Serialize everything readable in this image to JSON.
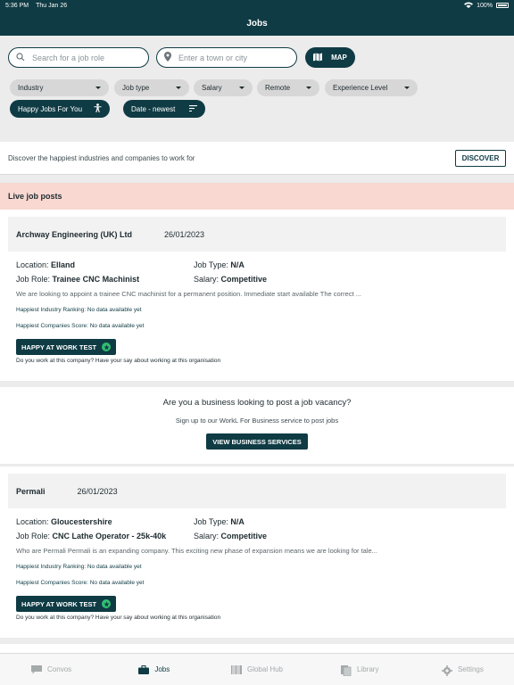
{
  "status_bar": {
    "time": "5:36 PM",
    "date": "Thu Jan 26",
    "battery": "100%"
  },
  "header": {
    "title": "Jobs"
  },
  "search": {
    "role_placeholder": "Search for a job role",
    "town_placeholder": "Enter a town or city",
    "map_label": "MAP"
  },
  "filters": {
    "industry": "Industry",
    "job_type": "Job type",
    "salary": "Salary",
    "remote": "Remote",
    "experience": "Experience Level",
    "happy_jobs": "Happy Jobs For You",
    "sort": "Date - newest"
  },
  "discover": {
    "text": "Discover the happiest industries and companies to work for",
    "button": "DISCOVER"
  },
  "live": {
    "title": "Live job posts"
  },
  "jobs": [
    {
      "company": "Archway Engineering (UK) Ltd",
      "date": "26/01/2023",
      "location_label": "Location:",
      "location": "Elland",
      "job_type_label": "Job Type:",
      "job_type": "N/A",
      "role_label": "Job Role:",
      "role": "Trainee CNC Machinist",
      "salary_label": "Salary:",
      "salary": "Competitive",
      "description": "We are looking to appoint a trainee CNC machinist for a permanent position. Immediate start available The correct ...",
      "industry_ranking": "Happiest Industry Ranking: No data available yet",
      "companies_score": "Happiest Companies Score: No data available yet",
      "test_button": "HAPPY AT WORK TEST",
      "note": "Do you work at this company? Have your say about working at this organisation"
    },
    {
      "company": "Permali",
      "date": "26/01/2023",
      "location_label": "Location:",
      "location": "Gloucestershire",
      "job_type_label": "Job Type:",
      "job_type": "N/A",
      "role_label": "Job Role:",
      "role": "CNC Lathe Operator - 25k-40k",
      "salary_label": "Salary:",
      "salary": "Competitive",
      "description": "Who are Permali Permali is an expanding company. This exciting new phase of expansion means we are looking for tale...",
      "industry_ranking": "Happiest Industry Ranking: No data available yet",
      "companies_score": "Happiest Companies Score: No data available yet",
      "test_button": "HAPPY AT WORK TEST",
      "note": "Do you work at this company? Have your say about working at this organisation"
    }
  ],
  "business": {
    "title": "Are you a business looking to post a job vacancy?",
    "subtitle": "Sign up to our WorkL For Business service to post jobs",
    "button": "VIEW BUSINESS SERVICES"
  },
  "tabs": [
    {
      "label": "Convos",
      "icon": "chat-icon"
    },
    {
      "label": "Jobs",
      "icon": "briefcase-icon"
    },
    {
      "label": "Global Hub",
      "icon": "barcode-icon"
    },
    {
      "label": "Library",
      "icon": "library-icon"
    },
    {
      "label": "Settings",
      "icon": "gear-icon"
    }
  ],
  "colors": {
    "primary": "#0f3b44",
    "live_band": "#f9d8d2",
    "accent_green": "#2fbf71"
  }
}
